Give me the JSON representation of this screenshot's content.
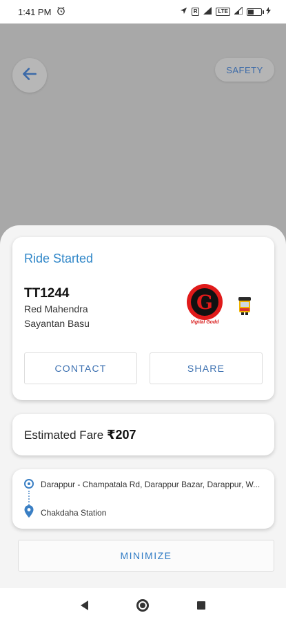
{
  "status_bar": {
    "time": "1:41 PM",
    "alarm_icon": "alarm-icon",
    "icons": [
      "location-icon",
      "volte-icon",
      "signal-icon",
      "lte-icon",
      "signal-icon",
      "battery-icon",
      "charging-icon"
    ],
    "volte_label": "R",
    "lte_label": "LTE",
    "battery_level": 45
  },
  "map": {
    "back_icon": "arrow-left-icon",
    "safety_label": "SAFETY"
  },
  "ride_card": {
    "status": "Ride Started",
    "vehicle_number": "TT1244",
    "vehicle_model": "Red Mahendra",
    "driver_name": "Sayantan Basu",
    "logo_letter": "G",
    "logo_text": "Vigital Godd",
    "contact_label": "CONTACT",
    "share_label": "SHARE"
  },
  "fare": {
    "label": "Estimated Fare ",
    "value": "₹207"
  },
  "route": {
    "pickup": "Darappur - Champatala Rd, Darappur Bazar, Darappur, W...",
    "drop": "Chakdaha Station"
  },
  "minimize_label": "MINIMIZE",
  "colors": {
    "accent": "#2f86c8",
    "map_overlay": "#a8a8a8",
    "logo_red": "#e01a1a"
  }
}
